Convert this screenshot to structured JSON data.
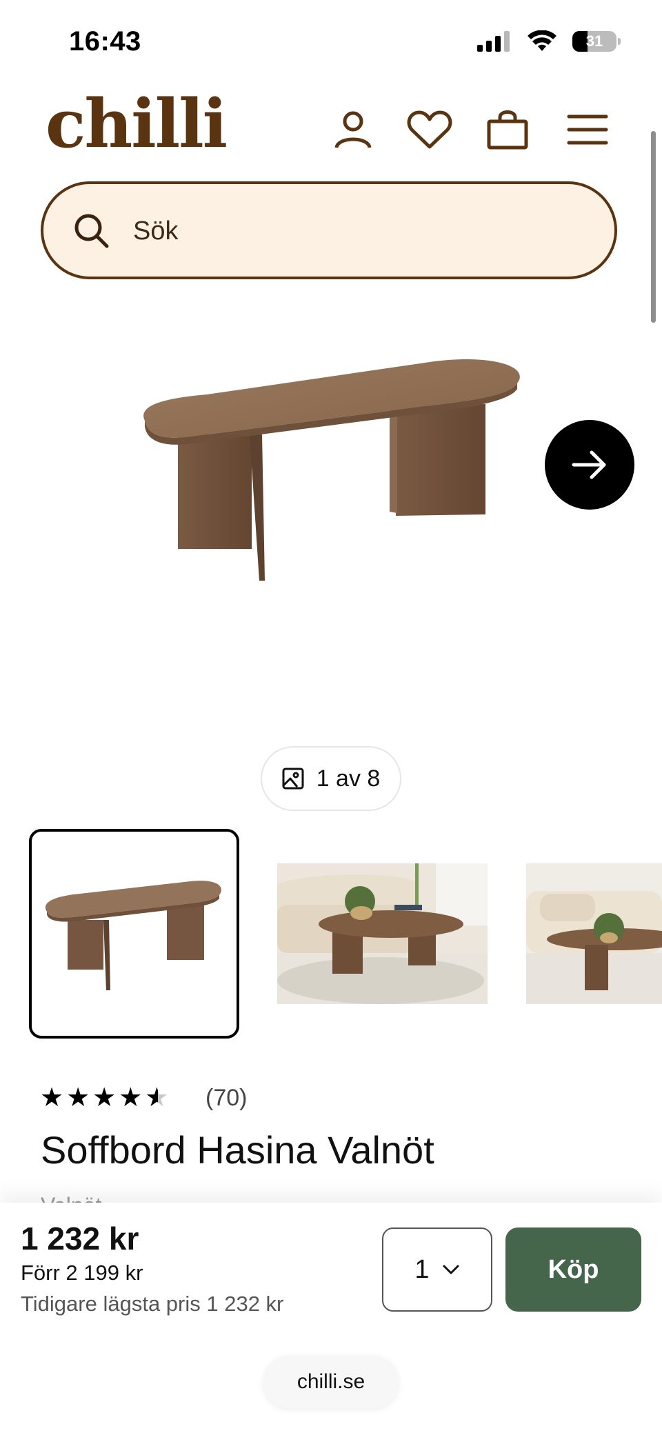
{
  "status_bar": {
    "time": "16:43",
    "battery": "31",
    "icons": [
      "cellular-signal-icon",
      "wifi-icon",
      "battery-icon"
    ]
  },
  "header": {
    "logo": "chilli",
    "icons": [
      "user-icon",
      "heart-icon",
      "shopping-bag-icon",
      "hamburger-menu-icon"
    ]
  },
  "search": {
    "placeholder": "Sök"
  },
  "gallery": {
    "counter": "1 av 8",
    "next_icon": "arrow-right-icon",
    "thumbnails": [
      "product-only",
      "living-room-sofa",
      "living-room-sofa-2"
    ]
  },
  "product": {
    "rating": 4.5,
    "rating_count": "(70)",
    "title": "Soffbord Hasina Valnöt",
    "partial_text": "Valnöt"
  },
  "purchase": {
    "price": "1 232 kr",
    "price_before": "Förr 2 199 kr",
    "lowest_price": "Tidigare lägsta pris 1 232 kr",
    "quantity": "1",
    "buy_label": "Köp"
  },
  "browser": {
    "url": "chilli.se"
  },
  "colors": {
    "brand_brown": "#5a3310",
    "search_bg": "#fdf1e4",
    "buy_green": "#45664b"
  }
}
